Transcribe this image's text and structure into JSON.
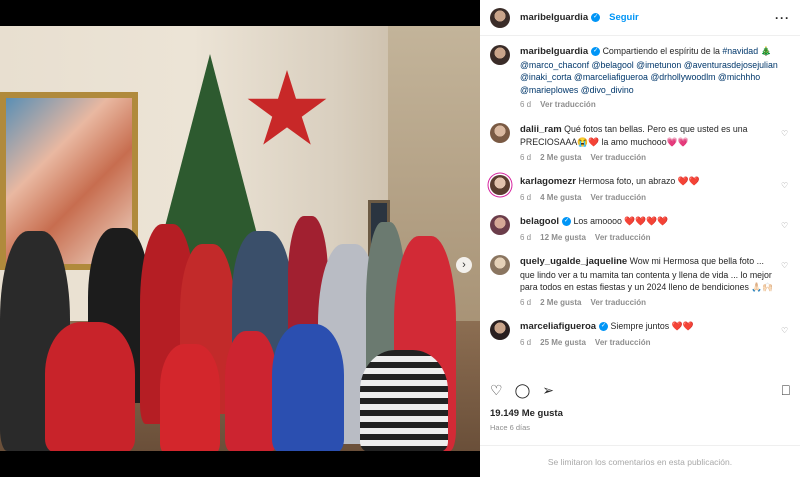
{
  "post": {
    "username": "maribelguardia",
    "follow_label": "Seguir",
    "more_icon": "more-horizontal-icon",
    "accent": "#0095f6",
    "caption": {
      "text_before": "Compartiendo el espíritu de la ",
      "hashtag": "#navidad",
      "emoji": "🎄",
      "mentions": "@marco_chaconf @belagool @imetunon @aventurasdejosejulian @inaki_corta @marceliafigueroa @drhollywoodlm @michhho @marieplowes @divo_divino",
      "time": "6 d",
      "translate": "Ver traducción"
    },
    "likes": "19.149 Me gusta",
    "ago": "Hace 6 días",
    "limited": "Se limitaron los comentarios en esta publicación."
  },
  "comments": [
    {
      "user": "dalii_ram",
      "text": "Qué fotos tan bellas. Pero es que usted es una PRECIOSAAA😭❤️ la amo muchooo💗💗",
      "time": "6 d",
      "likes": "2 Me gusta",
      "translate": "Ver traducción",
      "verified": false
    },
    {
      "user": "karlagomezr",
      "text": "Hermosa foto, un abrazo ❤️❤️",
      "time": "6 d",
      "likes": "4 Me gusta",
      "translate": "Ver traducción",
      "verified": false
    },
    {
      "user": "belagool",
      "text": "Los amoooo ❤️❤️❤️❤️",
      "time": "6 d",
      "likes": "12 Me gusta",
      "translate": "Ver traducción",
      "verified": true
    },
    {
      "user": "quely_ugalde_jaqueline",
      "text": "Wow mi Hermosa que bella foto ... que lindo ver a tu mamita tan contenta y llena de vida ... lo mejor para todos en estas fiestas y un 2024 lleno de bendiciones 🙏🏻🙌🏻",
      "time": "6 d",
      "likes": "2 Me gusta",
      "translate": "Ver traducción",
      "verified": false
    },
    {
      "user": "marceliafigueroa",
      "text": "Siempre juntos ❤️❤️",
      "time": "6 d",
      "likes": "25 Me gusta",
      "translate": "Ver traducción",
      "verified": true
    }
  ],
  "actions": {
    "like_icon": "heart-icon",
    "comment_icon": "comment-icon",
    "share_icon": "share-icon",
    "save_icon": "bookmark-icon"
  },
  "carousel": {
    "next_icon": "chevron-right-icon"
  }
}
